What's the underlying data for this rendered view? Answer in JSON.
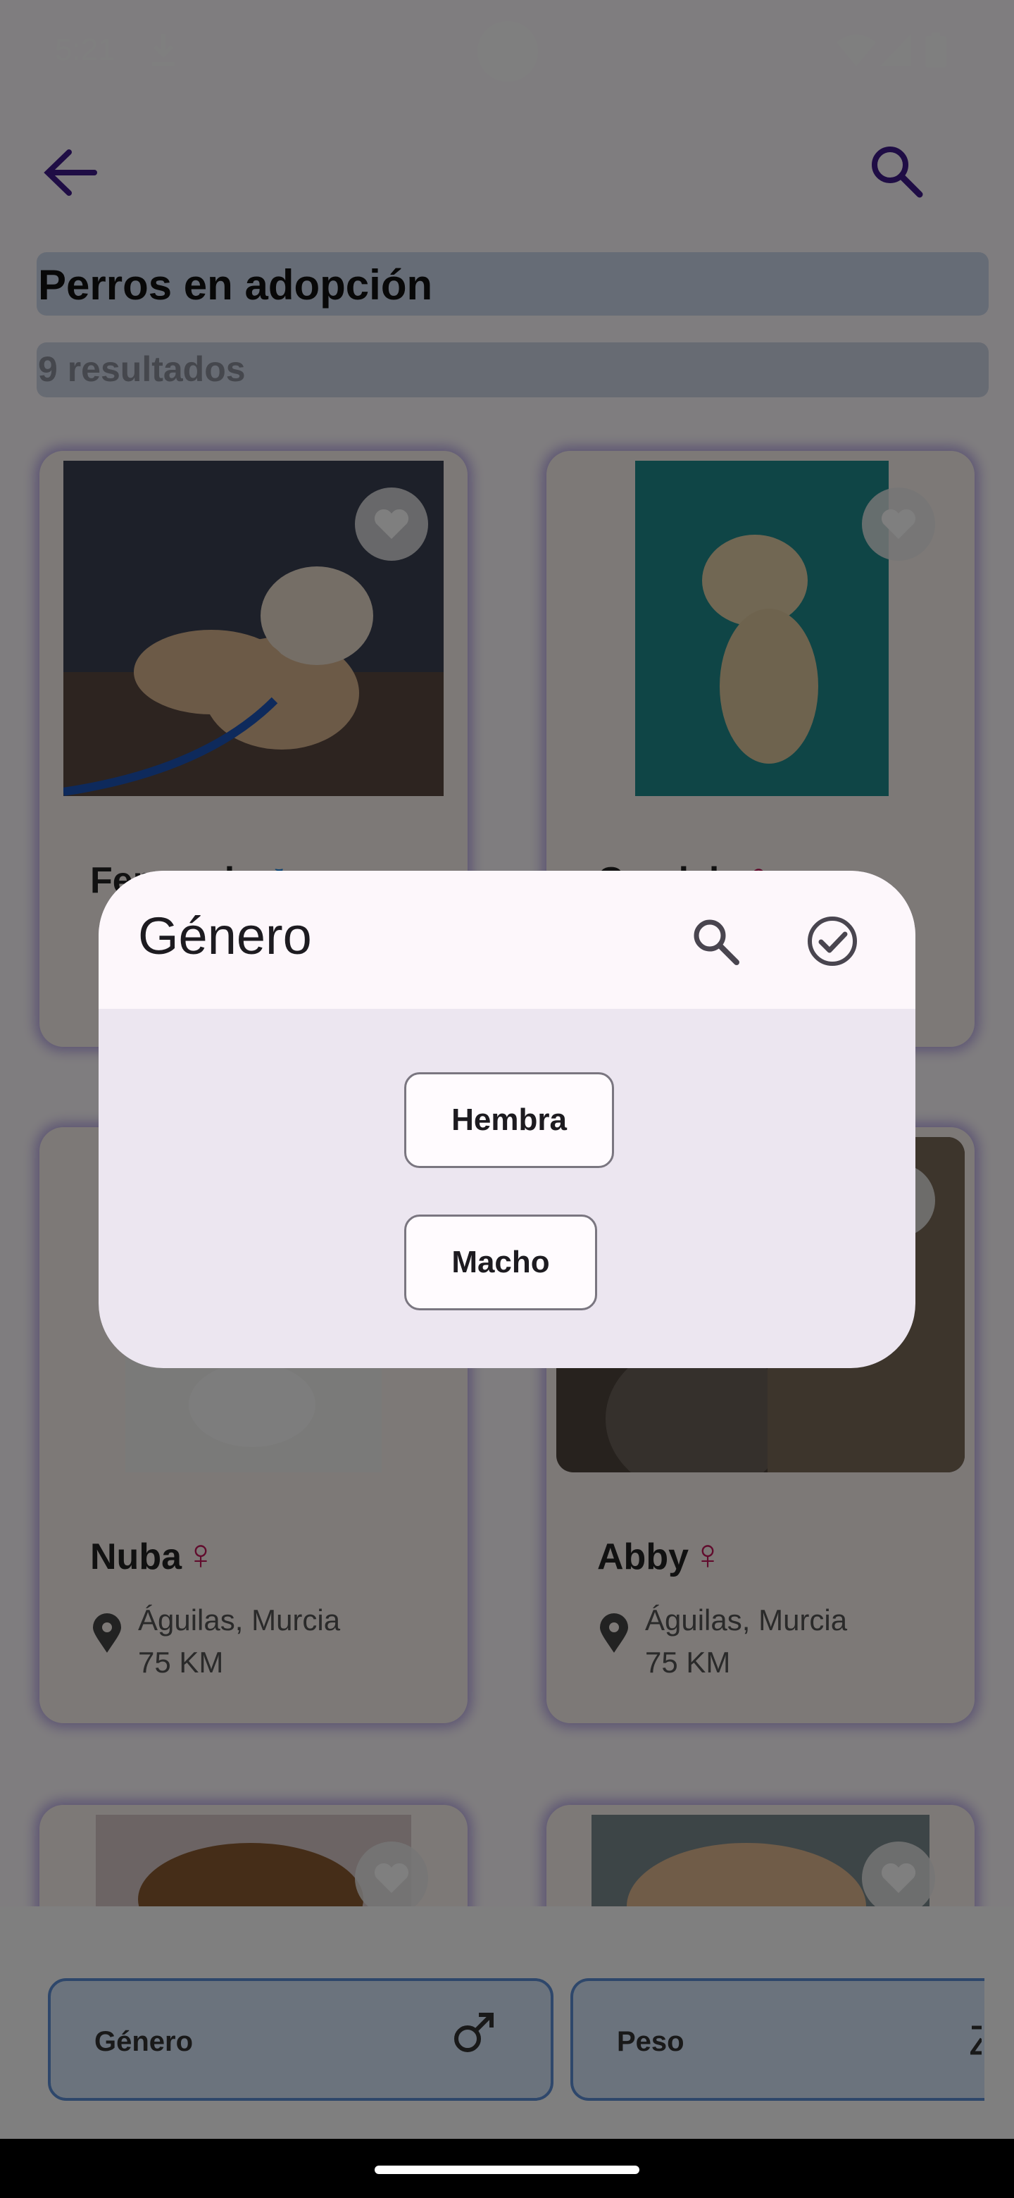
{
  "status_bar": {
    "time": "5:21"
  },
  "page": {
    "title": "Perros en adopción",
    "results": "9 resultados"
  },
  "cards": [
    {
      "name": "Fernanda",
      "gender_symbol": "♂",
      "gender": "male"
    },
    {
      "name": "Candela",
      "gender_symbol": "♀",
      "gender": "female"
    },
    {
      "name": "Nuba",
      "gender_symbol": "♀",
      "gender": "female",
      "location": "Águilas, Murcia",
      "distance": "75 KM"
    },
    {
      "name": "Abby",
      "gender_symbol": "♀",
      "gender": "female",
      "location": "Águilas, Murcia",
      "distance": "75 KM"
    }
  ],
  "filters": [
    {
      "label": "Género",
      "icon": "male-icon"
    },
    {
      "label": "Peso",
      "icon": "weight-icon"
    }
  ],
  "dialog": {
    "title": "Género",
    "options": [
      "Hembra",
      "Macho"
    ]
  },
  "colors": {
    "accent": "#3f1a8a",
    "female": "#c2185b",
    "male": "#1e88e5",
    "chip_bg": "#d7e6fb",
    "chip_border": "#5c8fd6"
  }
}
